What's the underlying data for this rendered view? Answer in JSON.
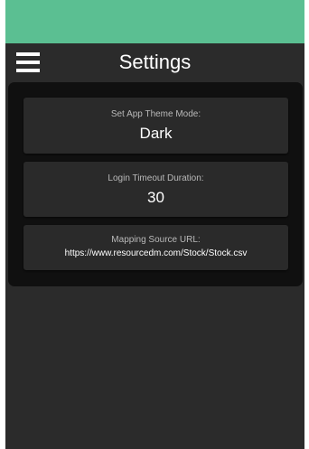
{
  "header": {
    "title": "Settings",
    "menu_icon": "hamburger-menu-icon"
  },
  "colors": {
    "status_bar": "#5bbf92",
    "background": "#2b2b2b",
    "panel": "#101010",
    "card": "#2a2a2a"
  },
  "settings": {
    "theme": {
      "label": "Set App Theme Mode:",
      "value": "Dark"
    },
    "timeout": {
      "label": "Login Timeout Duration:",
      "value": "30"
    },
    "mapping_url": {
      "label": "Mapping Source URL:",
      "value": "https://www.resourcedm.com/Stock/Stock.csv"
    }
  }
}
